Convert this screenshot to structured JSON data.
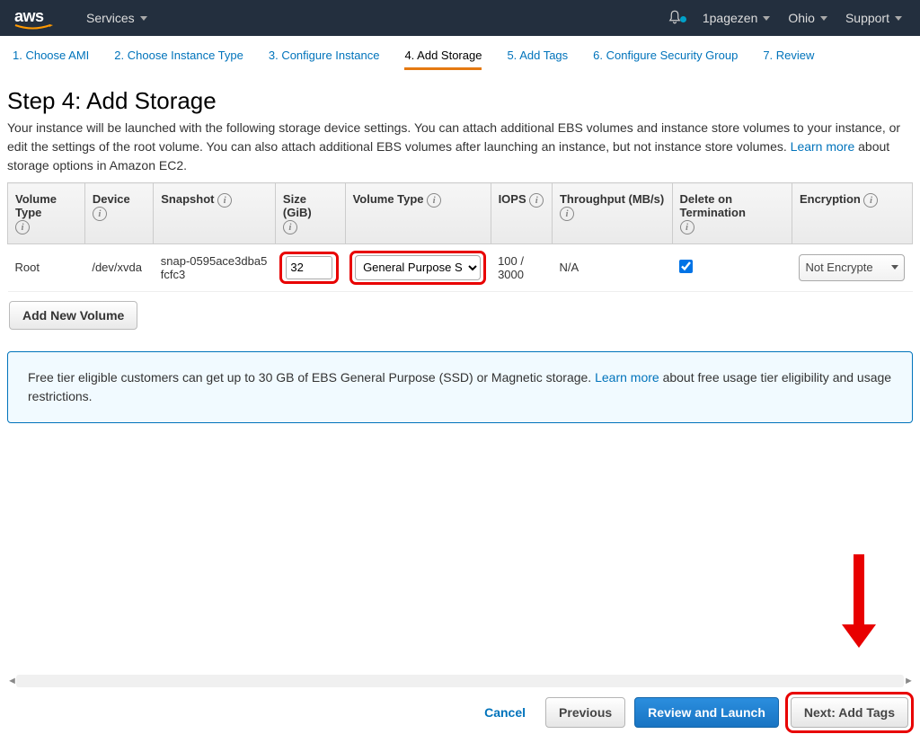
{
  "topnav": {
    "services": "Services",
    "account": "1pagezen",
    "region": "Ohio",
    "support": "Support"
  },
  "wizard": {
    "s1": "1. Choose AMI",
    "s2": "2. Choose Instance Type",
    "s3": "3. Configure Instance",
    "s4": "4. Add Storage",
    "s5": "5. Add Tags",
    "s6": "6. Configure Security Group",
    "s7": "7. Review"
  },
  "page": {
    "title": "Step 4: Add Storage",
    "desc_a": "Your instance will be launched with the following storage device settings. You can attach additional EBS volumes and instance store volumes to your instance, or edit the settings of the root volume. You can also attach additional EBS volumes after launching an instance, but not instance store volumes. ",
    "learn_more": "Learn more",
    "desc_b": " about storage options in Amazon EC2."
  },
  "table": {
    "headers": {
      "vol": "Volume Type",
      "dev": "Device",
      "snap": "Snapshot",
      "size": "Size (GiB)",
      "voltype": "Volume Type",
      "iops": "IOPS",
      "thr": "Throughput (MB/s)",
      "del": "Delete on Termination",
      "enc": "Encryption"
    },
    "row": {
      "vol": "Root",
      "dev": "/dev/xvda",
      "snap": "snap-0595ace3dba5fcfc3",
      "size": "32",
      "voltype": "General Purpose S",
      "iops": "100 / 3000",
      "thr": "N/A",
      "del_checked": true,
      "enc": "Not Encrypte"
    }
  },
  "add_button": "Add New Volume",
  "notice": {
    "text_a": "Free tier eligible customers can get up to 30 GB of EBS General Purpose (SSD) or Magnetic storage. ",
    "learn_more": "Learn more",
    "text_b": " about free usage tier eligibility and usage restrictions."
  },
  "footer": {
    "cancel": "Cancel",
    "previous": "Previous",
    "review": "Review and Launch",
    "next": "Next: Add Tags"
  }
}
